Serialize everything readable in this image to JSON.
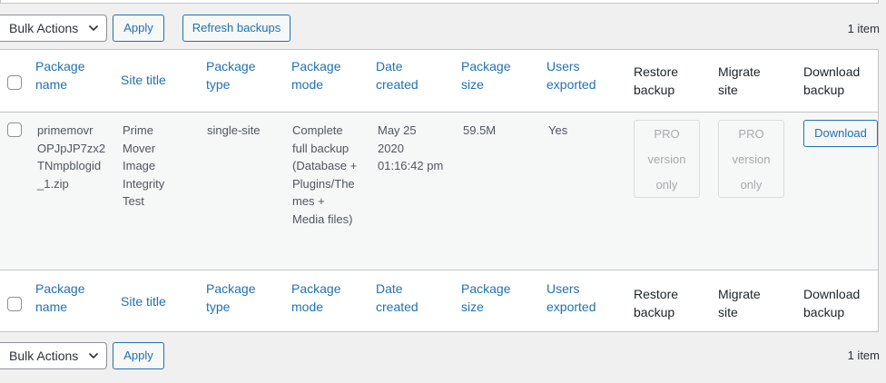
{
  "toolbar": {
    "bulk_actions": "Bulk Actions",
    "apply": "Apply",
    "refresh": "Refresh backups",
    "items_count": "1 item"
  },
  "columns": {
    "package_name": [
      "Package",
      "name"
    ],
    "site_title": "Site title",
    "package_type": [
      "Package",
      "type"
    ],
    "package_mode": [
      "Package",
      "mode"
    ],
    "date_created": [
      "Date",
      "created"
    ],
    "package_size": [
      "Package",
      "size"
    ],
    "users_exported": [
      "Users",
      "exported"
    ],
    "restore_backup": [
      "Restore",
      "backup"
    ],
    "migrate_site": [
      "Migrate",
      "site"
    ],
    "download_backup": [
      "Download",
      "backup"
    ]
  },
  "row": {
    "package_name": [
      "primemovr",
      "OPJpJP7zx2",
      "TNmpblogid",
      "_1.zip"
    ],
    "site_title": [
      "Prime",
      "Mover",
      "Image",
      "Integrity",
      "Test"
    ],
    "package_type": "single-site",
    "package_mode": [
      "Complete",
      "full backup",
      "(Database +",
      "Plugins/The",
      "mes +",
      "Media files)"
    ],
    "date_created": [
      "May 25",
      "2020",
      "01:16:42 pm"
    ],
    "package_size": "59.5M",
    "users_exported": "Yes",
    "restore_pro": [
      "PRO",
      "version",
      "only"
    ],
    "migrate_pro": [
      "PRO",
      "version",
      "only"
    ],
    "download_button": "Download"
  },
  "colors": {
    "link": "#2271b1",
    "border": "#c3c4c7",
    "muted": "#a7aaad"
  }
}
